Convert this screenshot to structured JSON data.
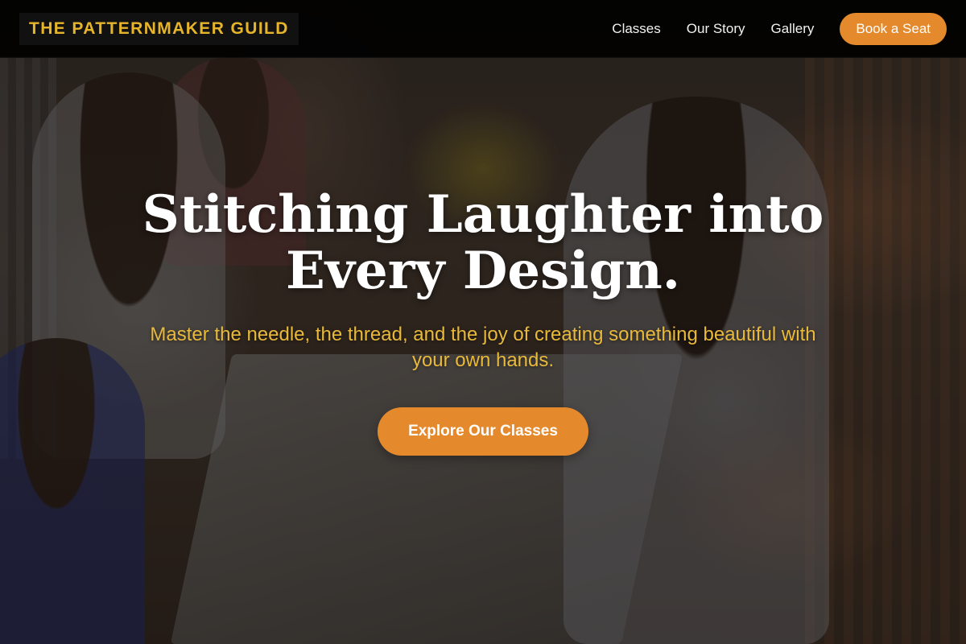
{
  "navbar": {
    "brand": "THE PATTERNMAKER GUILD",
    "links": [
      {
        "label": "Classes"
      },
      {
        "label": "Our Story"
      },
      {
        "label": "Gallery"
      }
    ],
    "cta_label": "Book a Seat"
  },
  "hero": {
    "title": "Stitching Laughter into Every Design.",
    "subtitle": "Master the needle, the thread, and the joy of creating something beautiful with your own hands.",
    "cta_label": "Explore Our Classes"
  },
  "colors": {
    "accent": "#e58a2c",
    "brand_gold": "#e7b52a",
    "subtitle_gold": "#e9b93a",
    "navbar_bg": "#000000"
  }
}
